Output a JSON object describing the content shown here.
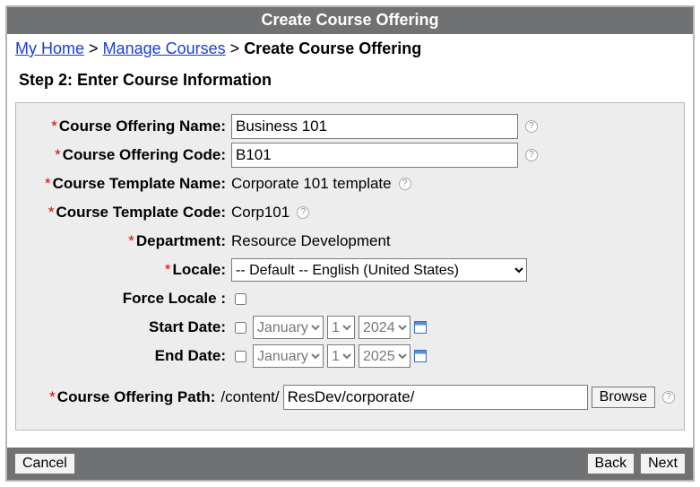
{
  "title": "Create Course Offering",
  "breadcrumb": {
    "home": "My Home",
    "manage": "Manage Courses",
    "current": "Create Course Offering",
    "sep": ">"
  },
  "step_heading": "Step 2: Enter Course Information",
  "labels": {
    "name": "Course Offering Name:",
    "code": "Course Offering Code:",
    "tmpl_name": "Course Template Name:",
    "tmpl_code": "Course Template Code:",
    "department": "Department:",
    "locale": "Locale:",
    "force_locale": "Force Locale :",
    "start_date": "Start Date:",
    "end_date": "End Date:",
    "path": "Course Offering Path:"
  },
  "values": {
    "name": "Business 101",
    "code": "B101",
    "tmpl_name": "Corporate 101 template",
    "tmpl_code": "Corp101",
    "department": "Resource Development",
    "locale_selected": "-- Default -- English (United States)",
    "path_prefix": "/content/",
    "path": "ResDev/corporate/"
  },
  "dates": {
    "months": [
      "January"
    ],
    "days": [
      "1"
    ],
    "start_year": "2024",
    "end_year": "2025"
  },
  "buttons": {
    "browse": "Browse",
    "cancel": "Cancel",
    "back": "Back",
    "next": "Next"
  },
  "required_marker": "*"
}
